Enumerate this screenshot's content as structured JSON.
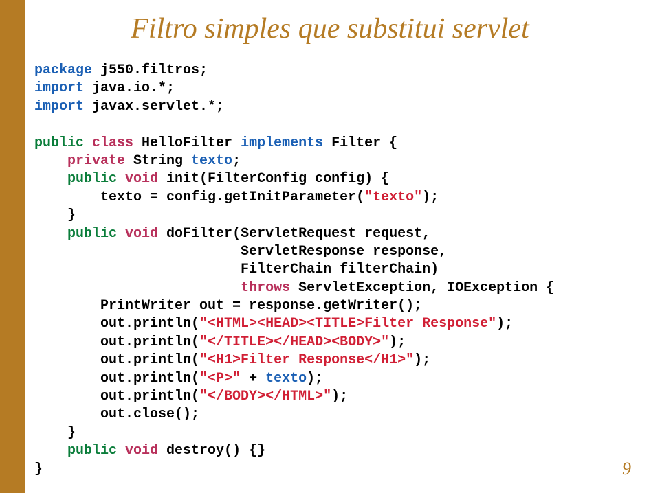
{
  "slide": {
    "title": "Filtro simples que substitui servlet",
    "page_number": "9"
  },
  "code": {
    "l01a": "package ",
    "l01b": "j550.filtros;",
    "l02a": "import ",
    "l02b": "java.io.*;",
    "l03a": "import ",
    "l03b": "javax.servlet.*;",
    "blank1": "",
    "l04a": "public ",
    "l04b": "class ",
    "l04c": "HelloFilter ",
    "l04d": "implements ",
    "l04e": "Filter {",
    "l05a": "    ",
    "l05b": "private ",
    "l05c": "String ",
    "l05d": "texto",
    "l05e": ";",
    "l06a": "    ",
    "l06b": "public ",
    "l06c": "void ",
    "l06d": "init(FilterConfig config) {",
    "l07": "        texto = config.getInitParameter(\"texto\");",
    "l07_pre": "        texto = config.getInitParameter(",
    "l07_str": "\"texto\"",
    "l07_post": ");",
    "l08": "    }",
    "l09a": "    ",
    "l09b": "public ",
    "l09c": "void ",
    "l09d": "doFilter(ServletRequest request,",
    "l10": "                         ServletResponse response,",
    "l11": "                         FilterChain filterChain)",
    "l12a": "                         ",
    "l12b": "throws ",
    "l12c": "ServletException, IOException {",
    "l13": "        PrintWriter out = response.getWriter();",
    "l14_pre": "        out.println(",
    "l14_str": "\"<HTML><HEAD><TITLE>Filter Response\"",
    "l14_post": ");",
    "l15_pre": "        out.println(",
    "l15_str": "\"</TITLE></HEAD><BODY>\"",
    "l15_post": ");",
    "l16_pre": "        out.println(",
    "l16_str": "\"<H1>Filter Response</H1>\"",
    "l16_post": ");",
    "l17_pre": "        out.println(",
    "l17_str": "\"<P>\" ",
    "l17_mid": "+ ",
    "l17_var": "texto",
    "l17_post": ");",
    "l18_pre": "        out.println(",
    "l18_str": "\"</BODY></HTML>\"",
    "l18_post": ");",
    "l19": "        out.close();",
    "l20": "    }",
    "l21a": "    ",
    "l21b": "public ",
    "l21c": "void ",
    "l21d": "destroy() {}",
    "l22": "}"
  }
}
